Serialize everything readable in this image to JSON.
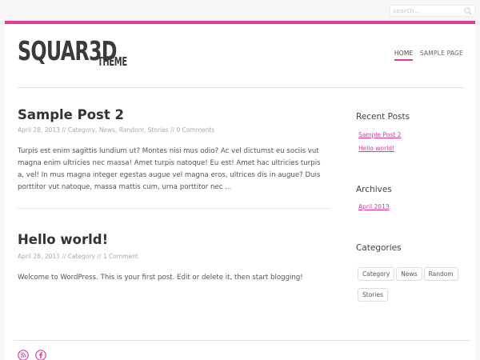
{
  "search": {
    "placeholder": "search..."
  },
  "logo": {
    "main": "SQUAR3D",
    "sub": "THEME"
  },
  "nav": [
    {
      "label": "HOME",
      "active": true
    },
    {
      "label": "SAMPLE PAGE",
      "active": false
    }
  ],
  "posts": [
    {
      "title": "Sample Post 2",
      "date": "April 28, 2013",
      "categories": [
        "Category",
        "News",
        "Random",
        "Stories"
      ],
      "comments": "0 Comments",
      "body": "Turpis est enim sagittis lundium ut? Montes nisi mus odio? Ac vel dictumst eu sociis vut magna enim ultricies nec massa! Amet turpis natoque! Eu est! Amet hac ultricies turpis a, vel! In mus magna integer egestas augue vel magna eros, ultrices dis in augue? Duis porttitor vut natoque, massa mattis cum, urna porttitor nec",
      "more": "..."
    },
    {
      "title": "Hello world!",
      "date": "April 28, 2013",
      "categories": [
        "Category"
      ],
      "comments": "1 Comment",
      "body": "Welcome to WordPress. This is your first post. Edit or delete it, then start blogging!"
    }
  ],
  "sidebar": {
    "recent_title": "Recent Posts",
    "recent": [
      "Sample Post 2",
      "Hello world!"
    ],
    "archives_title": "Archives",
    "archives": [
      "April 2013"
    ],
    "categories_title": "Categories",
    "categories": [
      "Category",
      "News",
      "Random",
      "Stories"
    ]
  },
  "footer": {
    "icons": [
      "rss-icon",
      "facebook-icon"
    ]
  },
  "colors": {
    "accent": "#df3b9b",
    "text": "#555555",
    "meta": "#aaaaaa",
    "background": "#f6f6f6"
  }
}
